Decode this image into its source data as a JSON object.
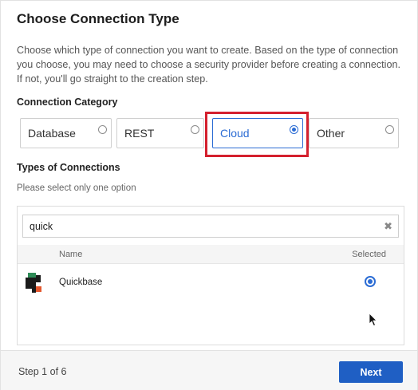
{
  "dialog": {
    "title": "Choose Connection Type",
    "description": "Choose which type of connection you want to create. Based on the type of connection you choose, you may need to choose a security provider before creating a connection. If not, you'll go straight to the creation step."
  },
  "category": {
    "label": "Connection Category",
    "options": [
      {
        "label": "Database",
        "selected": false
      },
      {
        "label": "REST",
        "selected": false
      },
      {
        "label": "Cloud",
        "selected": true
      },
      {
        "label": "Other",
        "selected": false
      }
    ]
  },
  "types": {
    "label": "Types of Connections",
    "hint": "Please select only one option",
    "search_value": "quick",
    "clear_icon": "clear-icon",
    "columns": {
      "name": "Name",
      "selected": "Selected"
    },
    "rows": [
      {
        "name": "Quickbase",
        "selected": true,
        "icon": "quickbase-logo"
      }
    ]
  },
  "footer": {
    "step": "Step 1 of 6",
    "next_label": "Next"
  },
  "colors": {
    "accent": "#2b6cd4",
    "highlight": "#d4202e",
    "button": "#1f5fc4"
  }
}
